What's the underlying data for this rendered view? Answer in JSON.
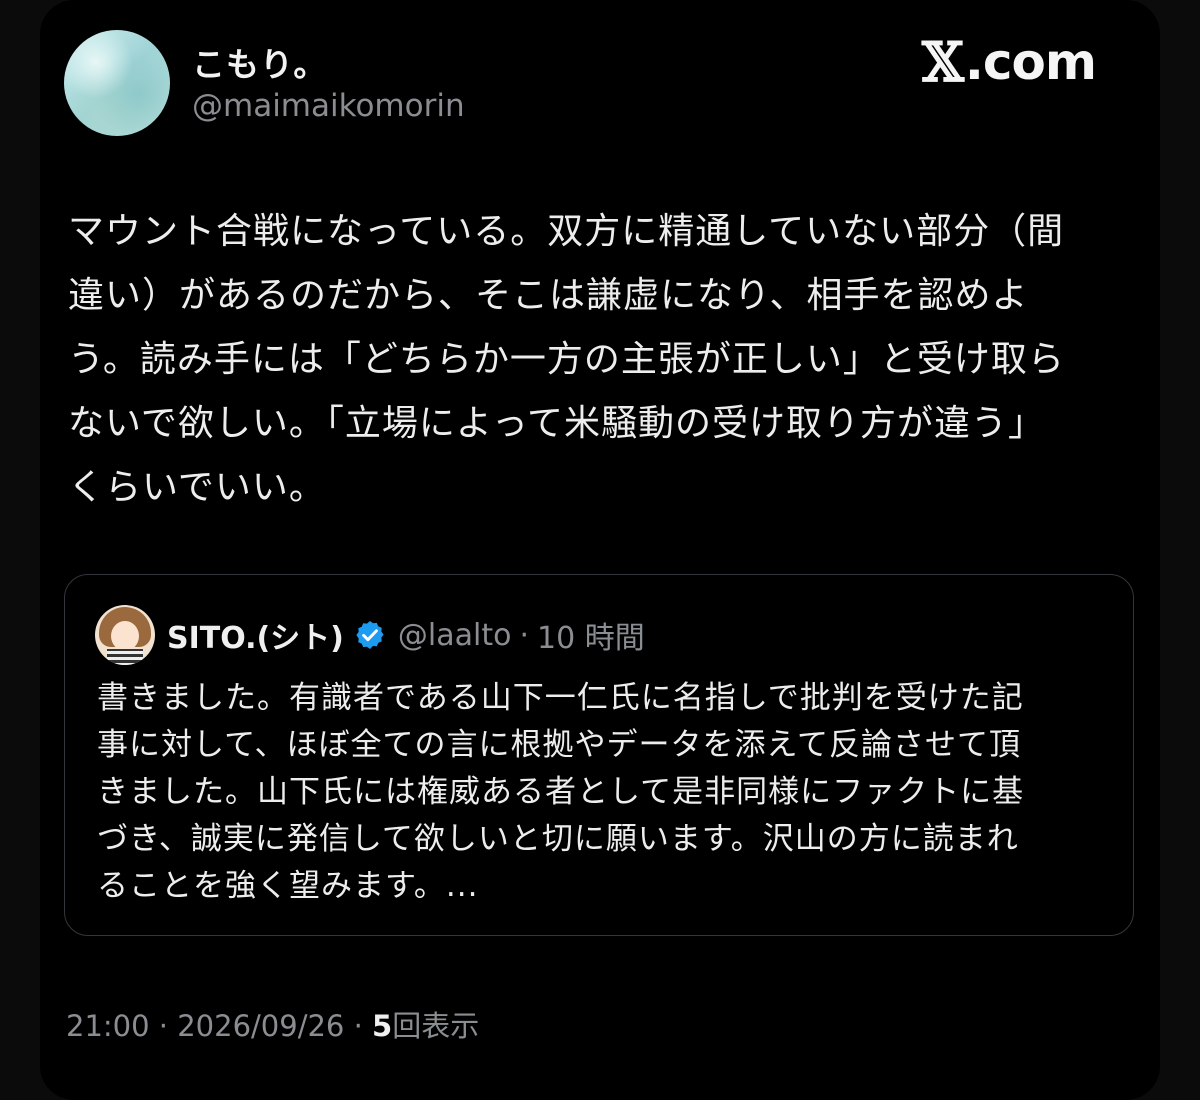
{
  "author": {
    "display_name": "こもり。",
    "handle": "@maimaikomorin"
  },
  "brand": {
    "logo_x": "𝕏",
    "logo_suffix": ".com"
  },
  "post": {
    "lines": [
      "マウント合戦になっている。双方に精通していない部分（間",
      "違い）があるのだから、そこは謙虚になり、相手を認めよ",
      "う。読み手には「どちらか一方の主張が正しい」と受け取ら",
      "ないで欲しい。「立場によって米騒動の受け取り方が違う」",
      "くらいでいい。"
    ]
  },
  "quoted": {
    "display_name": "SITO.(シト)",
    "handle": "@laalto",
    "separator": "·",
    "time": "10 時間",
    "verified_color": "#1d9bf0",
    "lines": [
      "書きました。有識者である山下一仁氏に名指しで批判を受けた記",
      "事に対して、ほぼ全ての言に根拠やデータを添えて反論させて頂",
      "きました。山下氏には権威ある者として是非同様にファクトに基",
      "づき、誠実に発信して欲しいと切に願います。沢山の方に読まれ",
      "ることを強く望みます。..."
    ]
  },
  "meta": {
    "time": "21:00",
    "sep1": "·",
    "date": "2026/09/26",
    "sep2": "·",
    "views_count": "5",
    "views_label": "回表示"
  }
}
